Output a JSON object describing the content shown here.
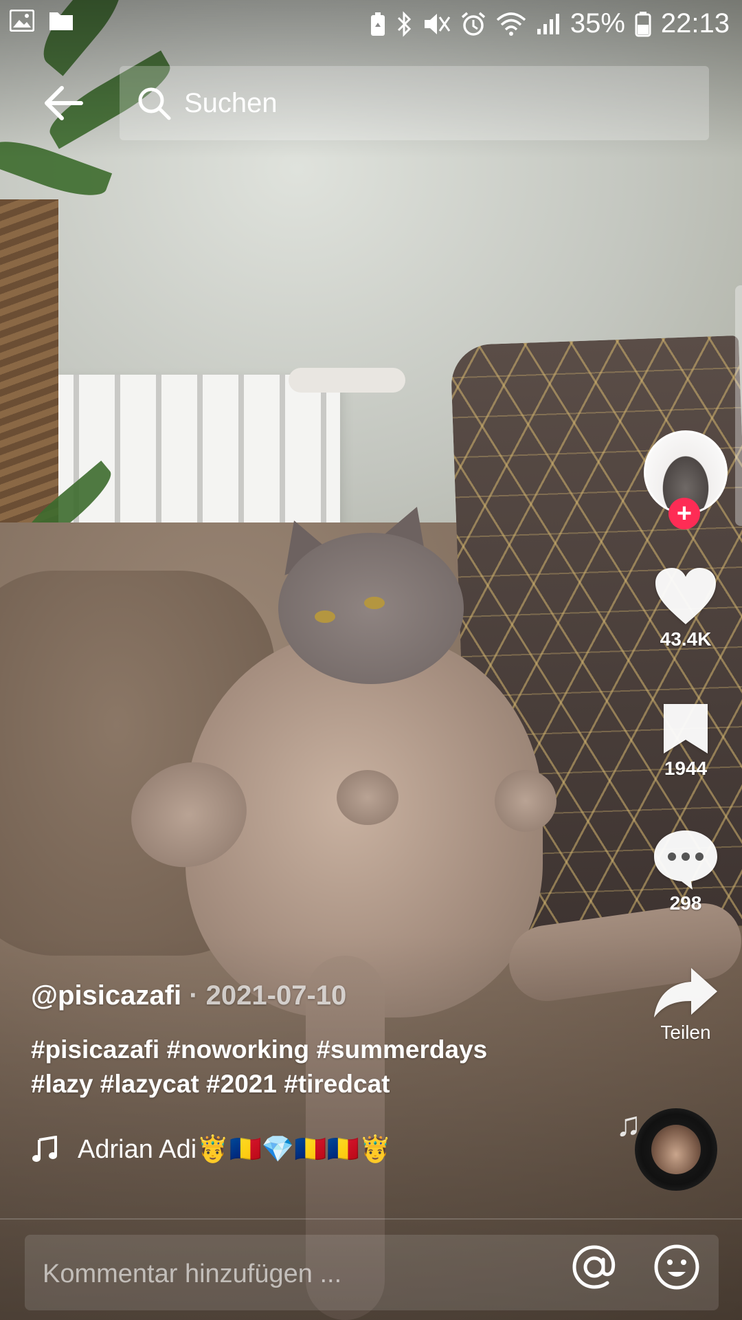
{
  "status_bar": {
    "battery_percent": "35%",
    "time": "22:13",
    "left_icons": [
      "image-icon",
      "folder-icon"
    ],
    "right_icons": [
      "battery-saver-icon",
      "bluetooth-icon",
      "mute-icon",
      "alarm-icon",
      "wifi-icon",
      "signal-icon",
      "battery-icon"
    ]
  },
  "search": {
    "placeholder": "Suchen"
  },
  "actions": {
    "likes": "43.4K",
    "saves": "1944",
    "comments": "298",
    "share_label": "Teilen"
  },
  "post": {
    "username": "@pisicazafi",
    "separator": "·",
    "date": "2021-07-10",
    "caption_line1": "#pisicazafi #noworking #summerdays",
    "caption_line2": "#lazy #lazycat #2021 #tiredcat",
    "music_title": "Adrian Adi🤴🇷🇴💎🇷🇴🇷🇴🤴"
  },
  "comment": {
    "placeholder": "Kommentar hinzufügen ..."
  },
  "colors": {
    "follow_badge": "#fe2c55",
    "text_primary": "#ffffff"
  }
}
